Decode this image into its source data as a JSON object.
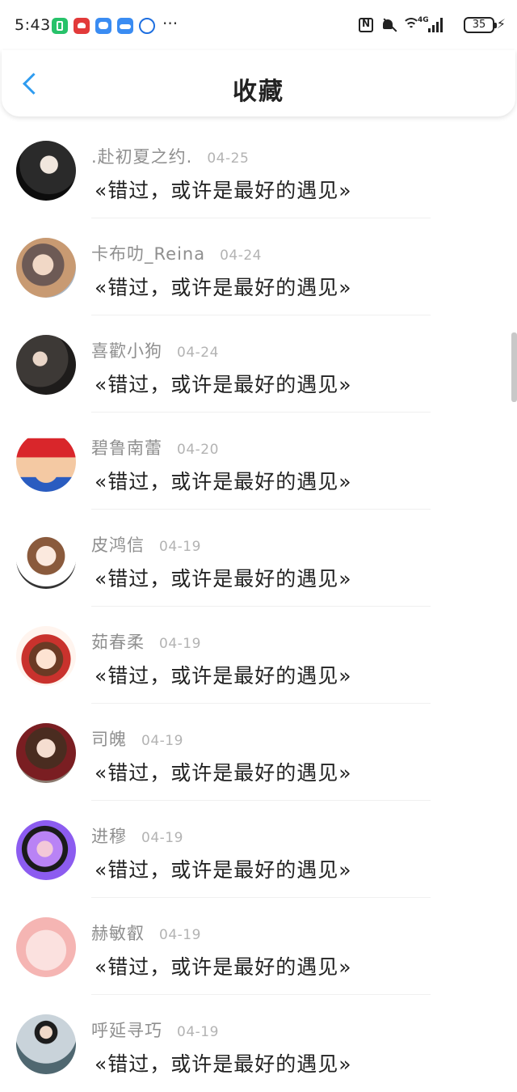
{
  "status_bar": {
    "time": "5:43",
    "more": "···",
    "network_label": "4G",
    "battery": "35"
  },
  "header": {
    "title": "收藏"
  },
  "colors": {
    "accent": "#2f9cf0",
    "username": "#8f8f8f",
    "date": "#b3b3b3"
  },
  "items": [
    {
      "username": ".赴初夏之约.",
      "date": "04-25",
      "title": "«错过，或许是最好的遇见»",
      "avatar_color": "#1a1a1a",
      "avatar_icon": "portrait-avatar"
    },
    {
      "username": "卡布叻_Reina",
      "date": "04-24",
      "title": "«错过，或许是最好的遇见»",
      "avatar_color": "#c9a07e",
      "avatar_icon": "portrait-avatar"
    },
    {
      "username": "喜歡小狗",
      "date": "04-24",
      "title": "«错过，或许是最好的遇见»",
      "avatar_color": "#3c3a38",
      "avatar_icon": "portrait-avatar"
    },
    {
      "username": "碧鲁南蕾",
      "date": "04-20",
      "title": "«错过，或许是最好的遇见»",
      "avatar_color": "#d9262b",
      "avatar_icon": "cartoon-avatar"
    },
    {
      "username": "皮鸿信",
      "date": "04-19",
      "title": "«错过，或许是最好的遇见»",
      "avatar_color": "#e8d5c4",
      "avatar_icon": "anime-avatar"
    },
    {
      "username": "茹春柔",
      "date": "04-19",
      "title": "«错过，或许是最好的遇见»",
      "avatar_color": "#f3d2c1",
      "avatar_icon": "cartoon-avatar"
    },
    {
      "username": "司魄",
      "date": "04-19",
      "title": "«错过，或许是最好的遇见»",
      "avatar_color": "#8a5a44",
      "avatar_icon": "portrait-avatar"
    },
    {
      "username": "进穆",
      "date": "04-19",
      "title": "«错过，或许是最好的遇见»",
      "avatar_color": "#9b6cf0",
      "avatar_icon": "portrait-avatar"
    },
    {
      "username": "赫敏叡",
      "date": "04-19",
      "title": "«错过，或许是最好的遇见»",
      "avatar_color": "#f5b5b3",
      "avatar_icon": "cartoon-avatar"
    },
    {
      "username": "呼延寻巧",
      "date": "04-19",
      "title": "«错过，或许是最好的遇见»",
      "avatar_color": "#5a6e73",
      "avatar_icon": "portrait-avatar"
    }
  ]
}
